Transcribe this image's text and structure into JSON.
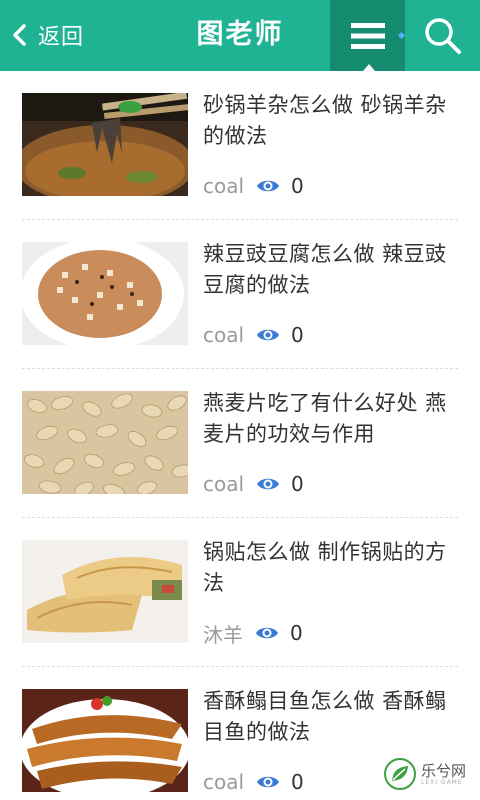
{
  "header": {
    "back_label": "返回",
    "title": "图老师",
    "accent_color": "#1fb394",
    "menu_color": "#148a6f",
    "icons": [
      "chevron-left-icon",
      "menu-icon",
      "search-icon"
    ]
  },
  "articles": [
    {
      "title": "砂锅羊杂怎么做 砂锅羊杂的做法",
      "author": "coal",
      "views": "0",
      "thumb": "mutton-offal-casserole"
    },
    {
      "title": "辣豆豉豆腐怎么做 辣豆豉豆腐的做法",
      "author": "coal",
      "views": "0",
      "thumb": "spicy-tofu-plate"
    },
    {
      "title": "燕麦片吃了有什么好处 燕麦片的功效与作用",
      "author": "coal",
      "views": "0",
      "thumb": "oat-flakes"
    },
    {
      "title": "锅贴怎么做 制作锅贴的方法",
      "author": "沐羊",
      "views": "0",
      "thumb": "potstickers"
    },
    {
      "title": "香酥鳎目鱼怎么做 香酥鳎目鱼的做法",
      "author": "coal",
      "views": "0",
      "thumb": "fried-fish"
    }
  ],
  "watermark": {
    "cn": "乐兮网",
    "en": "LEXI GAME"
  }
}
